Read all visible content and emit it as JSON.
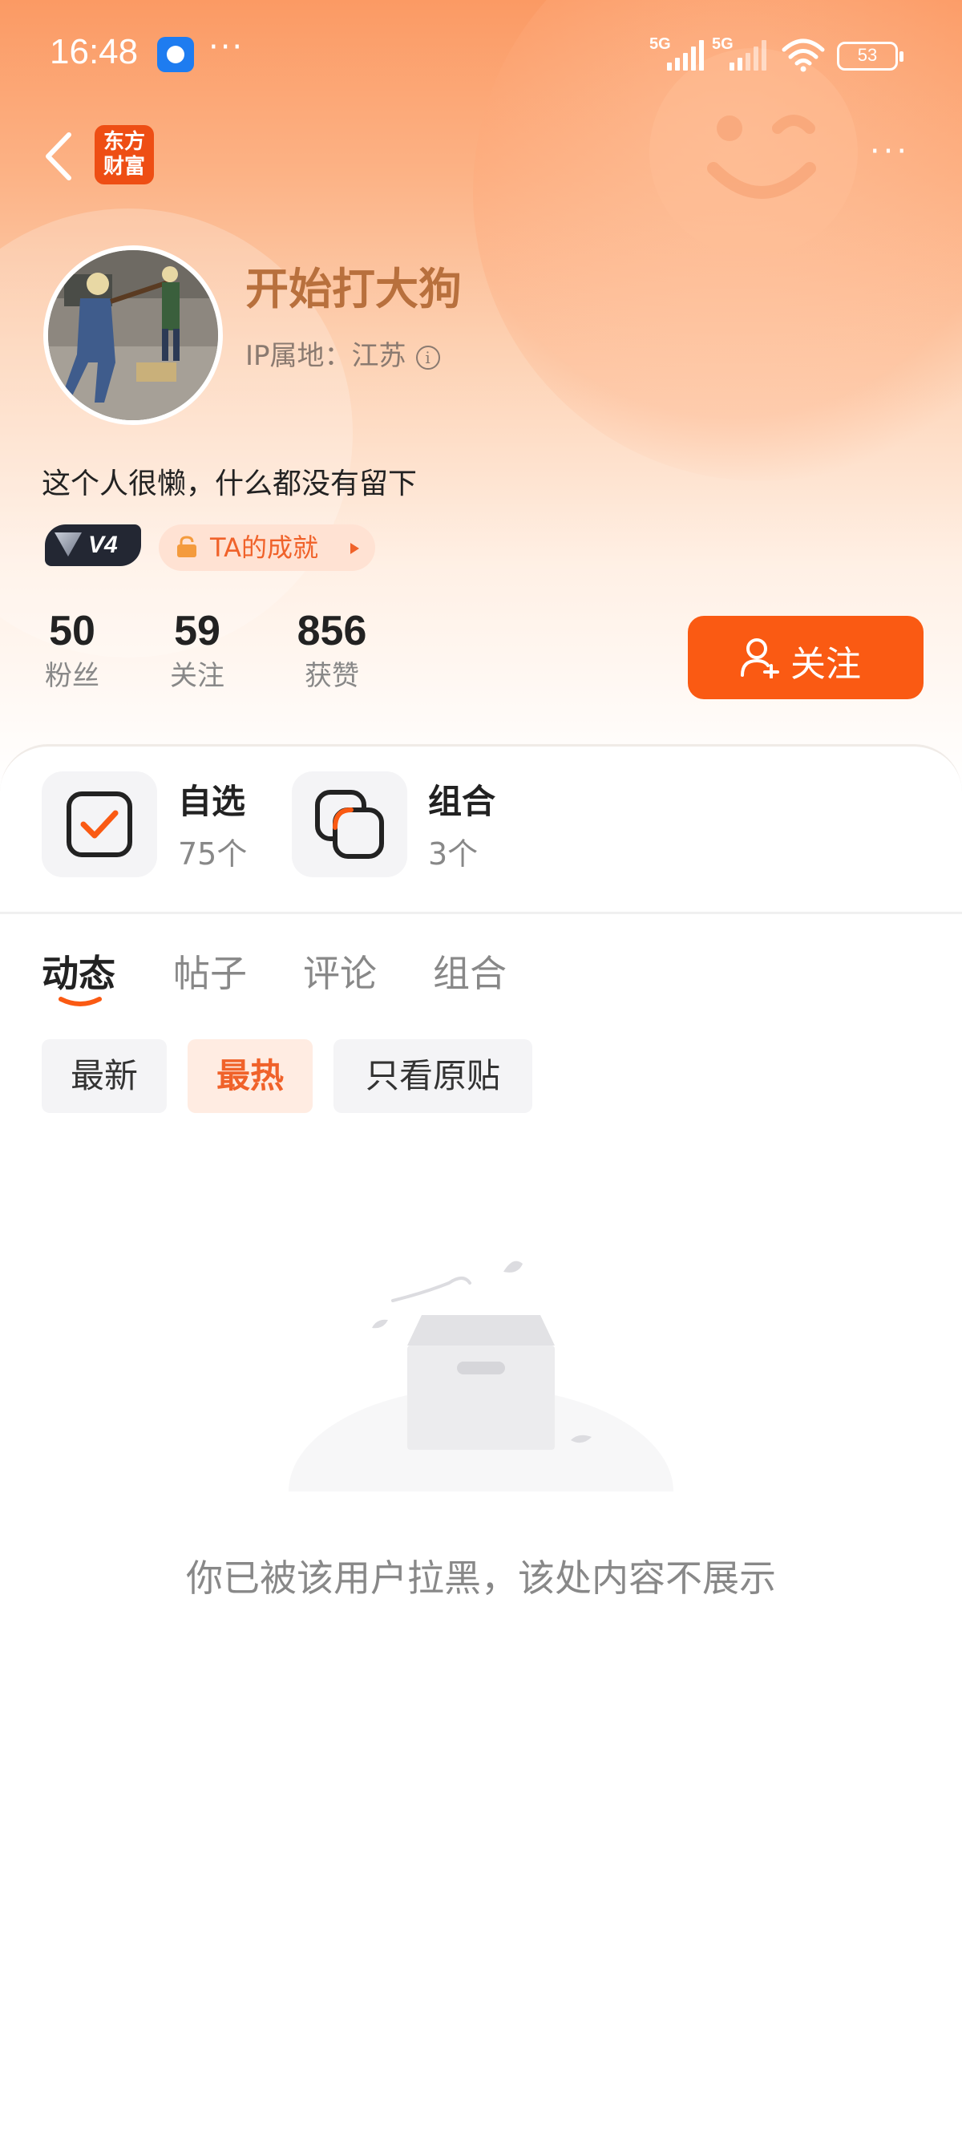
{
  "status_bar": {
    "time": "16:48",
    "more_dots": "···",
    "signal1_label": "5G",
    "signal2_label": "5G",
    "battery": "53"
  },
  "nav": {
    "logo_text": "东方\n财富",
    "more": "···"
  },
  "profile": {
    "username": "开始打大狗",
    "ip_label": "IP属地：江苏",
    "bio": "这个人很懒，什么都没有留下",
    "level_badge": "V4",
    "achievement": "TA的成就"
  },
  "stats": [
    {
      "value": "50",
      "label": "粉丝"
    },
    {
      "value": "59",
      "label": "关注"
    },
    {
      "value": "856",
      "label": "获赞"
    }
  ],
  "follow_button": "关注",
  "tiles": [
    {
      "title": "自选",
      "count": "75个"
    },
    {
      "title": "组合",
      "count": "3个"
    }
  ],
  "tabs": [
    "动态",
    "帖子",
    "评论",
    "组合"
  ],
  "active_tab": "动态",
  "filters": [
    "最新",
    "最热",
    "只看原贴"
  ],
  "active_filter": "最热",
  "empty_message": "你已被该用户拉黑，该处内容不展示",
  "colors": {
    "accent": "#fa5a13",
    "username": "#b8703d",
    "chip_active_bg": "#ffece2"
  }
}
